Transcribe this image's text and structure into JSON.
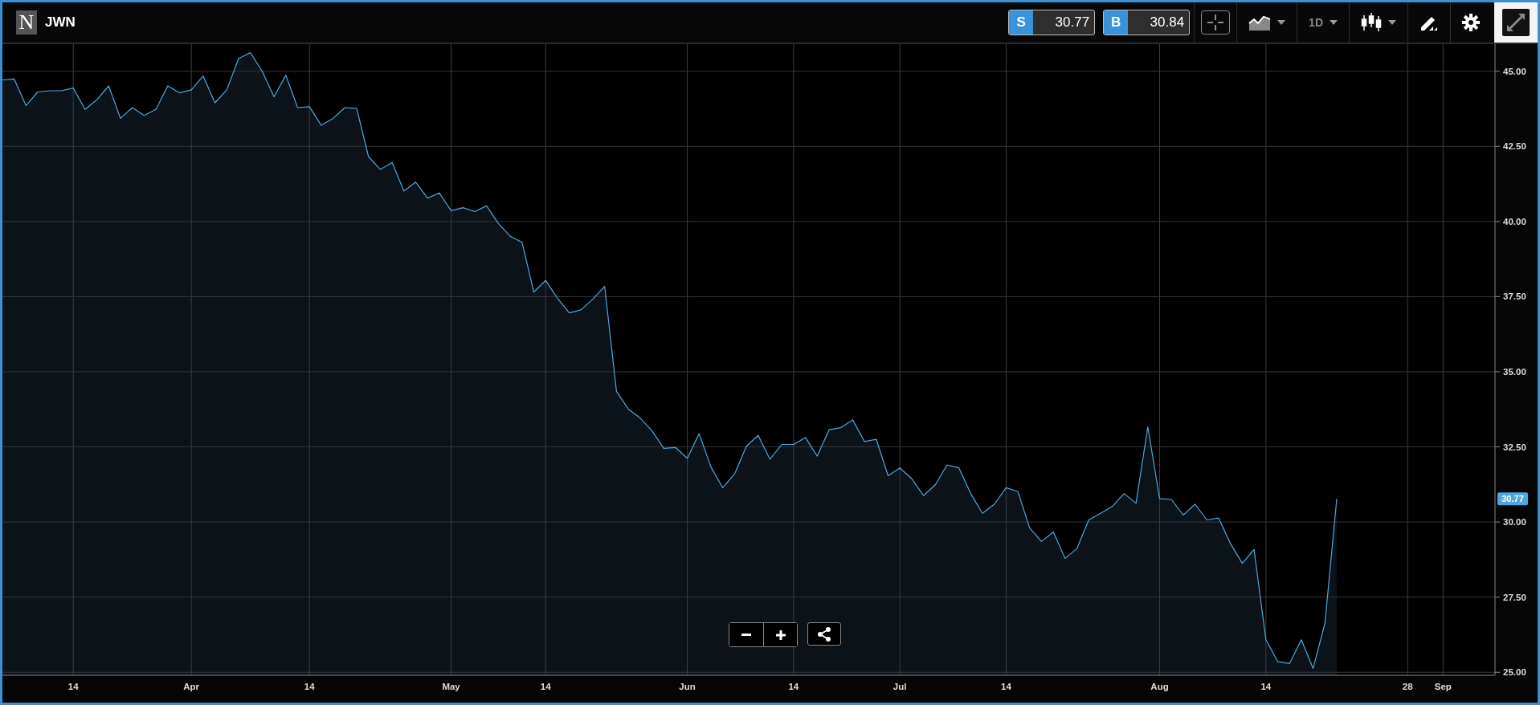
{
  "header": {
    "logo_letter": "N"
  },
  "quotes": [
    {
      "label": "S",
      "value": "30.77"
    },
    {
      "label": "B",
      "value": "30.84"
    }
  ],
  "interval": "1D",
  "chart": {
    "price_tag": "30.77",
    "chart_data": {
      "type": "area",
      "grid": true,
      "ylim": [
        24.9,
        45.9
      ],
      "yticks": [
        {
          "value": 25,
          "label": "25.00"
        },
        {
          "value": 27.5,
          "label": "27.50"
        },
        {
          "value": 30,
          "label": "30.00"
        },
        {
          "value": 32.5,
          "label": "32.50"
        },
        {
          "value": 35,
          "label": "35.00"
        },
        {
          "value": 37.5,
          "label": "37.50"
        },
        {
          "value": 40,
          "label": "40.00"
        },
        {
          "value": 42.5,
          "label": "42.50"
        },
        {
          "value": 45,
          "label": "45.00"
        }
      ],
      "categories": [
        null,
        null,
        null,
        null,
        null,
        null,
        "14",
        null,
        null,
        null,
        null,
        null,
        null,
        null,
        null,
        null,
        "Apr",
        null,
        null,
        null,
        null,
        null,
        null,
        null,
        null,
        null,
        "14",
        null,
        null,
        null,
        null,
        null,
        null,
        null,
        null,
        null,
        null,
        null,
        "May",
        null,
        null,
        null,
        null,
        null,
        null,
        null,
        "14",
        null,
        null,
        null,
        null,
        null,
        null,
        null,
        null,
        null,
        null,
        null,
        "Jun",
        null,
        null,
        null,
        null,
        null,
        null,
        null,
        null,
        "14",
        null,
        null,
        null,
        null,
        null,
        null,
        null,
        null,
        "Jul",
        null,
        null,
        null,
        null,
        null,
        null,
        null,
        null,
        "14",
        null,
        null,
        null,
        null,
        null,
        null,
        null,
        null,
        null,
        null,
        null,
        null,
        "Aug",
        null,
        null,
        null,
        null,
        null,
        null,
        null,
        null,
        "14",
        null,
        null,
        null,
        null,
        null,
        null,
        null,
        null,
        null,
        null,
        null,
        "28",
        null,
        null,
        "Sep",
        null,
        null,
        null,
        null
      ],
      "series": [
        {
          "name": "JWN",
          "color": "#4fa8dc",
          "values": [
            44.71,
            44.74,
            43.86,
            44.31,
            44.35,
            44.35,
            44.44,
            43.73,
            44.05,
            44.51,
            43.43,
            43.79,
            43.53,
            43.73,
            44.51,
            44.28,
            44.38,
            44.84,
            43.95,
            44.38,
            45.42,
            45.62,
            45.0,
            44.15,
            44.87,
            43.79,
            43.82,
            43.2,
            43.43,
            43.79,
            43.76,
            42.16,
            41.73,
            41.96,
            41.01,
            41.31,
            40.78,
            40.95,
            40.36,
            40.46,
            40.33,
            40.52,
            39.93,
            39.51,
            39.31,
            37.65,
            38.04,
            37.45,
            36.96,
            37.06,
            37.42,
            37.84,
            34.35,
            33.76,
            33.46,
            33.04,
            32.45,
            32.48,
            32.12,
            32.94,
            31.83,
            31.14,
            31.6,
            32.52,
            32.88,
            32.09,
            32.58,
            32.58,
            32.81,
            32.19,
            33.07,
            33.14,
            33.4,
            32.68,
            32.75,
            31.54,
            31.8,
            31.44,
            30.88,
            31.24,
            31.9,
            31.8,
            30.95,
            30.29,
            30.59,
            31.14,
            31.01,
            29.8,
            29.35,
            29.67,
            28.79,
            29.12,
            30.07,
            30.29,
            30.52,
            30.95,
            30.62,
            33.17,
            30.78,
            30.75,
            30.23,
            30.59,
            30.07,
            30.13,
            29.28,
            28.63,
            29.08,
            26.08,
            25.36,
            25.29,
            26.08,
            25.13,
            26.63,
            30.77,
            null,
            null,
            null,
            null,
            null,
            null,
            null,
            null,
            null,
            null,
            null,
            null,
            null
          ]
        }
      ]
    }
  }
}
